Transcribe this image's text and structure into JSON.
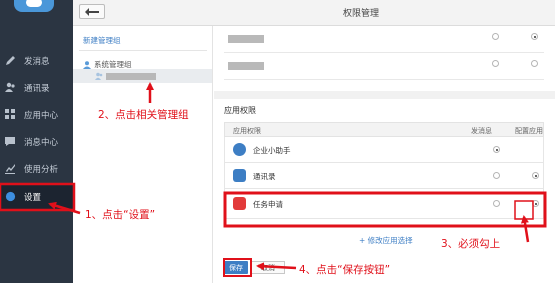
{
  "sidebar": {
    "items": [
      {
        "label": "发消息",
        "icon": "pencil-icon"
      },
      {
        "label": "通讯录",
        "icon": "contacts-icon"
      },
      {
        "label": "应用中心",
        "icon": "apps-icon"
      },
      {
        "label": "消息中心",
        "icon": "message-center-icon"
      },
      {
        "label": "使用分析",
        "icon": "analytics-icon"
      },
      {
        "label": "设置",
        "icon": "gear-icon"
      }
    ]
  },
  "topbar": {
    "title": "权限管理",
    "back_icon": "back-arrow-icon"
  },
  "groups": {
    "new_group": "新建管理组",
    "system_group": "系统管理组"
  },
  "permissions": {
    "section_title": "应用权限",
    "headers": {
      "app": "应用权限",
      "send": "发消息",
      "config": "配置应用"
    },
    "apps": [
      {
        "name": "企业小助手",
        "send": true,
        "config": false,
        "color": "#3d7ec4"
      },
      {
        "name": "通讯录",
        "send": false,
        "config": true,
        "color": "#3d7ec4"
      },
      {
        "name": "任务申请",
        "send": false,
        "config": true,
        "color": "#e23a3a"
      }
    ],
    "top_rows": [
      {
        "send": false,
        "config": true
      },
      {
        "send": false,
        "config": false
      }
    ],
    "modify_link": "+ 修改应用选择",
    "save": "保存",
    "cancel": "取消"
  },
  "annotations": {
    "step1": "1、点击“设置”",
    "step2": "2、点击相关管理组",
    "step3": "3、必须勾上",
    "step4": "4、点击“保存按钮”",
    "color": "#e0101a"
  }
}
